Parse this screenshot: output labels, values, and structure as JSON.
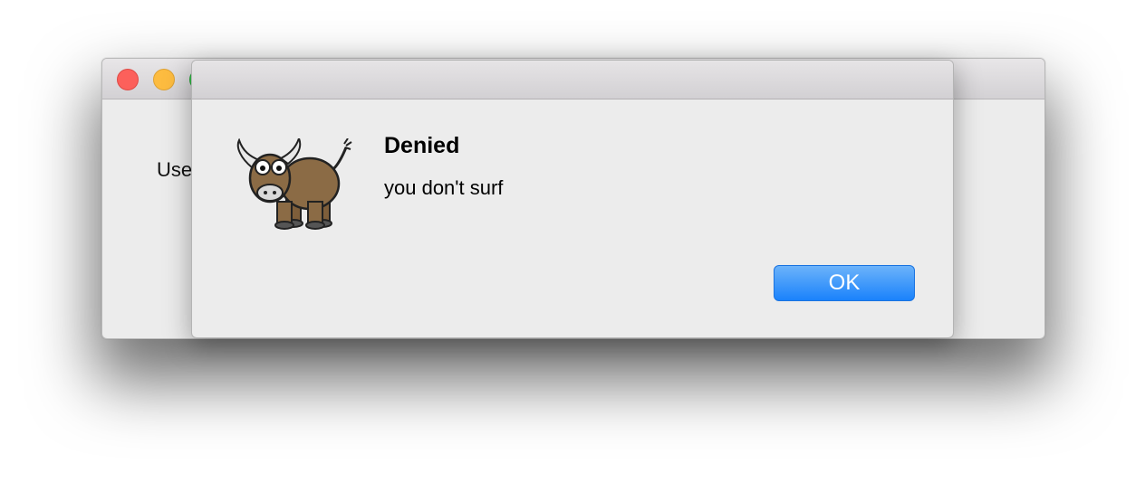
{
  "main_window": {
    "label": "Use"
  },
  "alert": {
    "icon": "yak-icon",
    "title": "Denied",
    "message": "you don't surf",
    "ok_label": "OK"
  },
  "colors": {
    "accent": "#1a82fb",
    "close": "#fc605b",
    "minimize": "#fdbc40",
    "zoom": "#34c84a"
  }
}
